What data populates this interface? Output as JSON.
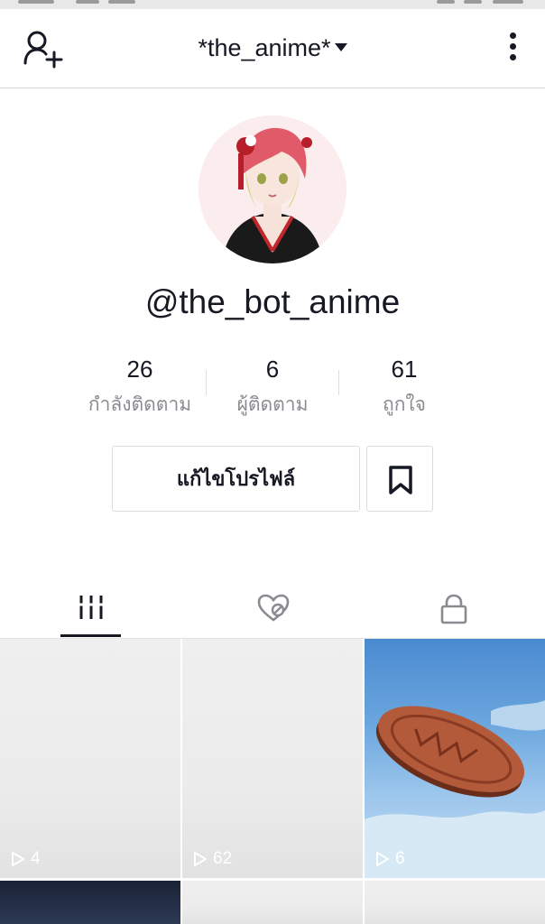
{
  "header": {
    "account_name": "*the_anime*",
    "add_friend_icon": "add-user-icon",
    "menu_icon": "more-vertical-icon"
  },
  "profile": {
    "username": "@the_bot_anime",
    "stats": [
      {
        "value": "26",
        "label": "กำลังติดตาม"
      },
      {
        "value": "6",
        "label": "ผู้ติดตาม"
      },
      {
        "value": "61",
        "label": "ถูกใจ"
      }
    ],
    "edit_profile_label": "แก้ไขโปรไฟล์",
    "bookmark_icon": "bookmark-icon"
  },
  "tabs": [
    {
      "icon": "grid-icon",
      "selected": true
    },
    {
      "icon": "liked-heart-icon",
      "selected": false
    },
    {
      "icon": "lock-icon",
      "selected": false
    }
  ],
  "videos": [
    {
      "plays": "4"
    },
    {
      "plays": "62"
    },
    {
      "plays": "6"
    }
  ],
  "colors": {
    "text": "#161823",
    "muted": "#8a8b91",
    "border": "#dcdcde",
    "background": "#ffffff"
  }
}
